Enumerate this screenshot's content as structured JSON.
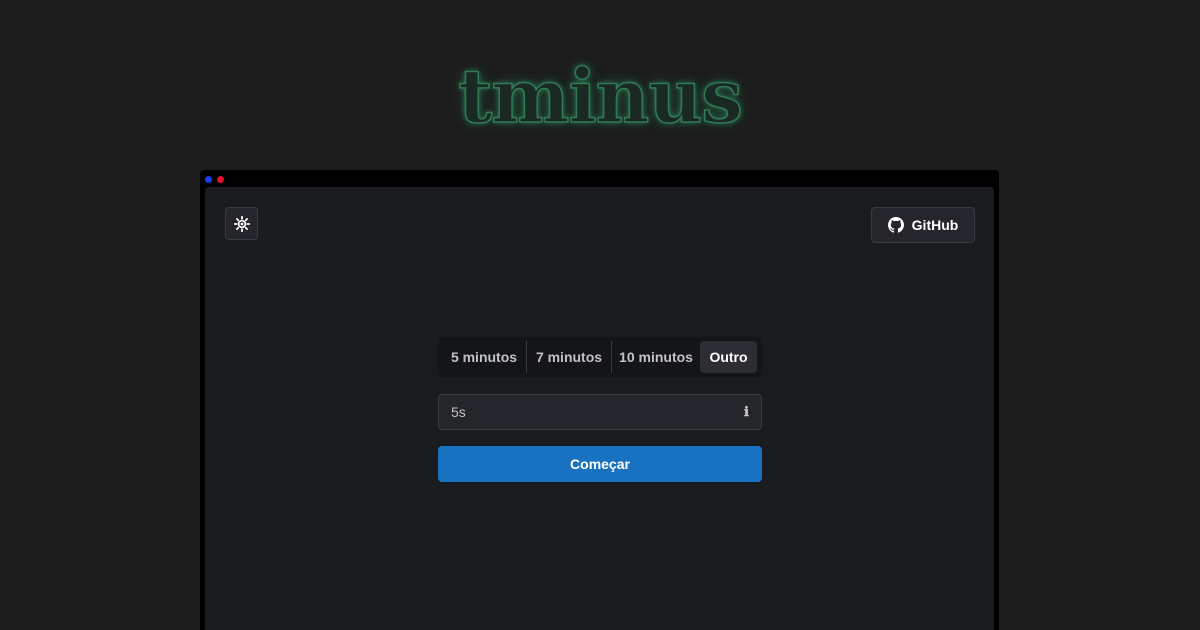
{
  "logo": {
    "text": "tminus",
    "accent_color": "#2f7a55"
  },
  "toolbar": {
    "theme_icon": "sun-icon",
    "github_label": "GitHub",
    "github_icon": "github-icon"
  },
  "durations": {
    "options": [
      "5 minutos",
      "7 minutos",
      "10 minutos",
      "Outro"
    ],
    "selected": "Outro"
  },
  "custom_duration": {
    "value": "5s",
    "info_icon": "info-icon"
  },
  "start": {
    "label": "Começar",
    "color": "#1971c2"
  },
  "window": {
    "dot_colors": [
      "#1e3cf0",
      "#e8102a"
    ]
  }
}
